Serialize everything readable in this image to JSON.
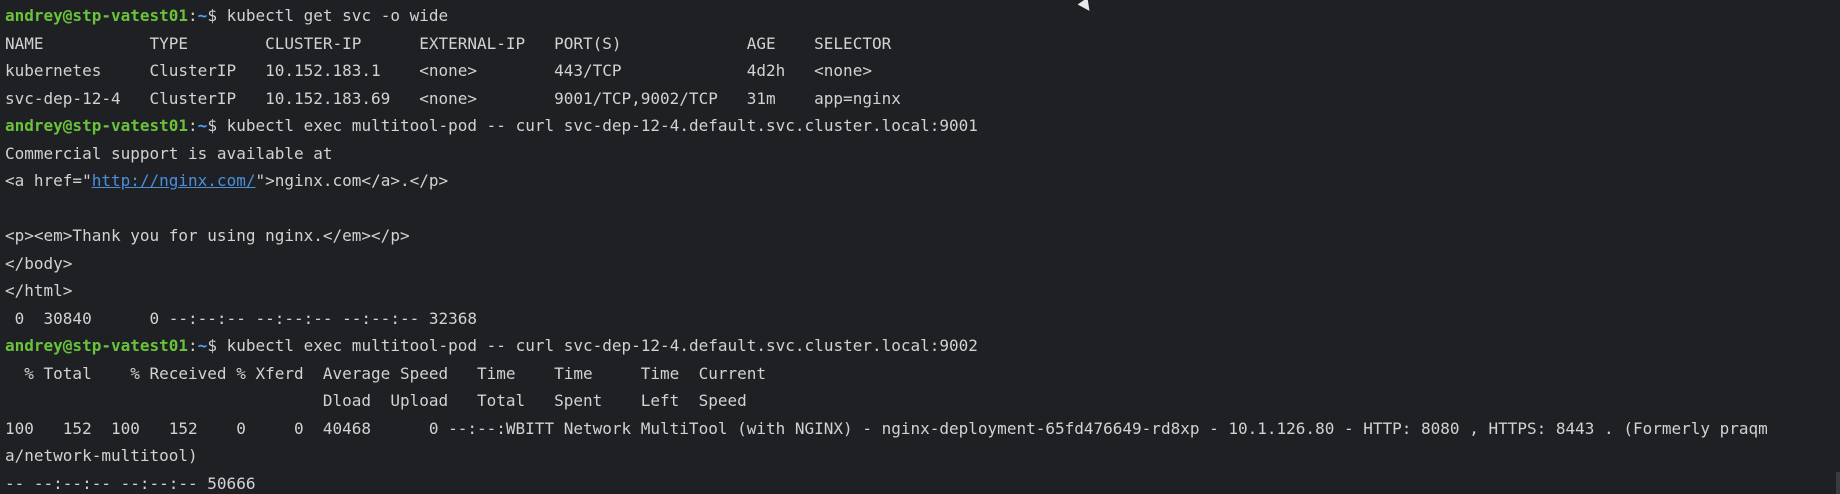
{
  "prompt": {
    "user": "andrey@stp-vatest01",
    "colon": ":",
    "path": "~",
    "symbol": "$ "
  },
  "lines": {
    "l1_cmd": "kubectl get svc -o wide",
    "l2": "NAME           TYPE        CLUSTER-IP      EXTERNAL-IP   PORT(S)             AGE    SELECTOR",
    "l3": "kubernetes     ClusterIP   10.152.183.1    <none>        443/TCP             4d2h   <none>",
    "l4": "svc-dep-12-4   ClusterIP   10.152.183.69   <none>        9001/TCP,9002/TCP   31m    app=nginx",
    "l5_cmd": "kubectl exec multitool-pod -- curl svc-dep-12-4.default.svc.cluster.local:9001",
    "l6": "Commercial support is available at",
    "l7_pre": "<a href=\"",
    "l7_link": "http://nginx.com/",
    "l7_post": "\">nginx.com</a>.</p>",
    "l8": "",
    "l9": "<p><em>Thank you for using nginx.</em></p>",
    "l10": "</body>",
    "l11": "</html>",
    "l12": " 0  30840      0 --:--:-- --:--:-- --:--:-- 32368",
    "l13_cmd": "kubectl exec multitool-pod -- curl svc-dep-12-4.default.svc.cluster.local:9002",
    "l14": "  % Total    % Received % Xferd  Average Speed   Time    Time     Time  Current",
    "l15": "                                 Dload  Upload   Total   Spent    Left  Speed",
    "l16": "100   152  100   152    0     0  40468      0 --:--:WBITT Network MultiTool (with NGINX) - nginx-deployment-65fd476649-rd8xp - 10.1.126.80 - HTTP: 8080 , HTTPS: 8443 . (Formerly praqm",
    "l17": "a/network-multitool)",
    "l18": "-- --:--:-- --:--:-- 50666"
  }
}
